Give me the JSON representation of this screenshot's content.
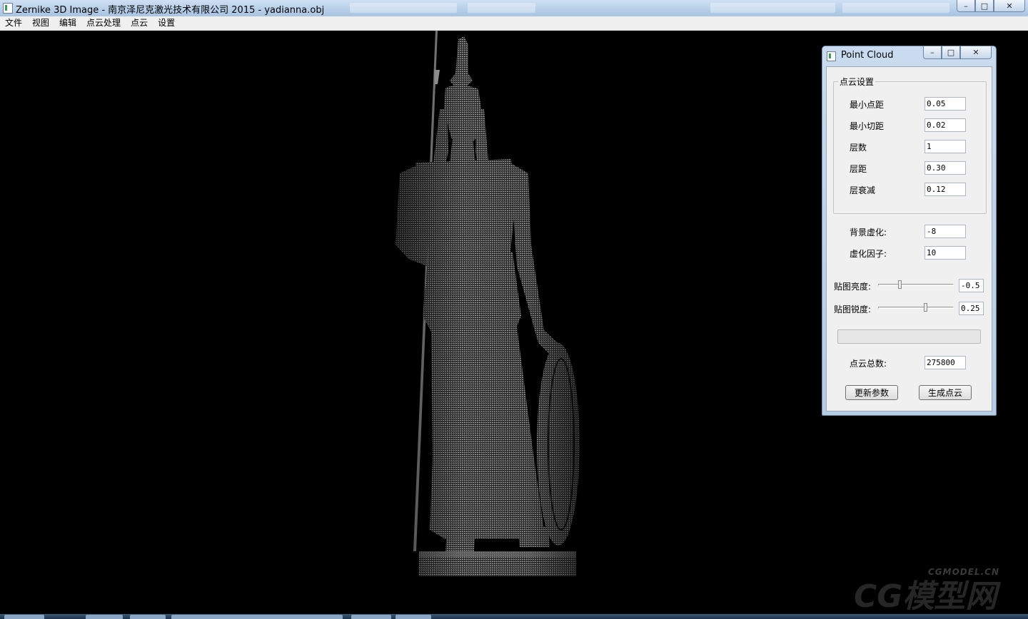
{
  "window": {
    "title": "Zernike 3D Image - 南京泽尼克激光技术有限公司 2015 - yadianna.obj",
    "controls": {
      "minimize": "–",
      "maximize": "□",
      "close": "✕"
    }
  },
  "menu": [
    "文件",
    "视图",
    "编辑",
    "点云处理",
    "点云",
    "设置"
  ],
  "viewport": {
    "description_icon": "statue-point-cloud-render",
    "watermark": {
      "small": "CGMODEL.CN",
      "big": "CG模型网"
    }
  },
  "dialog": {
    "title": "Point Cloud",
    "controls": {
      "minimize": "–",
      "maximize": "□",
      "close": "✕"
    },
    "group": {
      "label": "点云设置",
      "fields": [
        {
          "label": "最小点距",
          "value": "0.05"
        },
        {
          "label": "最小切距",
          "value": "0.02"
        },
        {
          "label": "层数",
          "value": "1"
        },
        {
          "label": "层距",
          "value": "0.30"
        },
        {
          "label": "层衰减",
          "value": "0.12"
        }
      ]
    },
    "blur": [
      {
        "label": "背景虚化:",
        "value": "-8"
      },
      {
        "label": "虚化因子:",
        "value": "10"
      }
    ],
    "sliders": [
      {
        "label": "贴图亮度:",
        "value": "-0.5",
        "position": 0.28
      },
      {
        "label": "贴图锐度:",
        "value": "0.25",
        "position": 0.62
      }
    ],
    "progress": {
      "value": 0
    },
    "total": {
      "label": "点云总数:",
      "value": "275800"
    },
    "buttons": {
      "update": "更新参数",
      "generate": "生成点云"
    }
  }
}
